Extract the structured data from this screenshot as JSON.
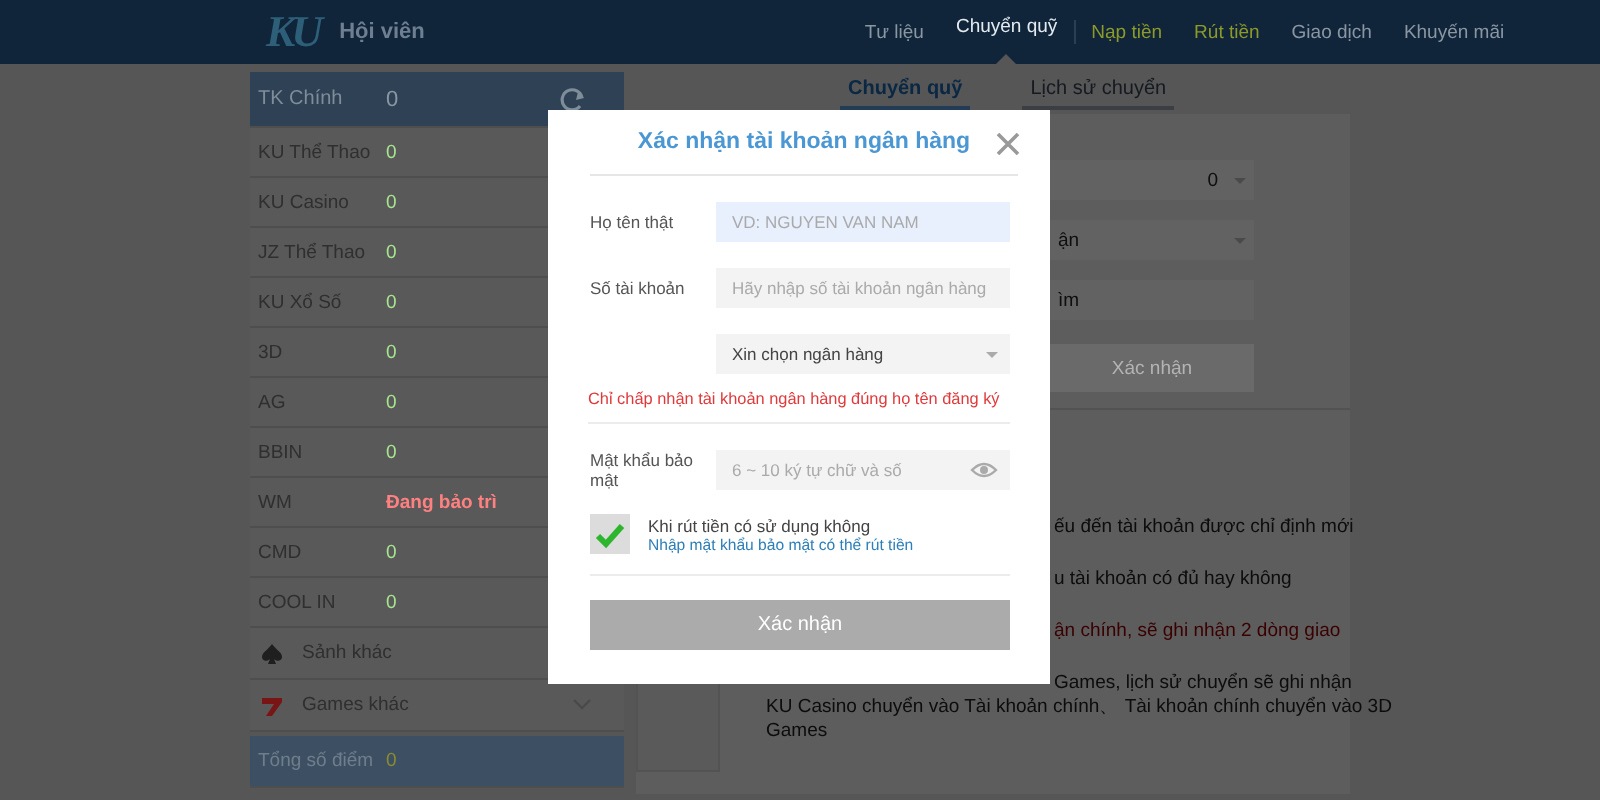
{
  "header": {
    "logo": "KU",
    "title": "Hội viên",
    "nav": [
      {
        "label": "Tư liệu",
        "selected": false,
        "kind": "normal"
      },
      {
        "label": "Chuyển quỹ",
        "selected": true,
        "kind": "normal"
      },
      {
        "label": "Nạp tiền",
        "selected": false,
        "kind": "highlight"
      },
      {
        "label": "Rút tiền",
        "selected": false,
        "kind": "highlight"
      },
      {
        "label": "Giao dịch",
        "selected": false,
        "kind": "normal"
      },
      {
        "label": "Khuyến mãi",
        "selected": false,
        "kind": "normal"
      }
    ]
  },
  "sidebar": {
    "main": {
      "label": "TK Chính",
      "value": "0"
    },
    "items": [
      {
        "kind": "balance",
        "label": "KU Thể Thao",
        "value": "0"
      },
      {
        "kind": "balance",
        "label": "KU Casino",
        "value": "0"
      },
      {
        "kind": "balance",
        "label": "JZ Thể Thao",
        "value": "0"
      },
      {
        "kind": "balance",
        "label": "KU Xổ Số",
        "value": "0"
      },
      {
        "kind": "balance",
        "label": "3D",
        "value": "0"
      },
      {
        "kind": "balance",
        "label": "AG",
        "value": "0"
      },
      {
        "kind": "balance",
        "label": "BBIN",
        "value": "0"
      },
      {
        "kind": "warning",
        "label": "WM",
        "value": "Đang bảo trì"
      },
      {
        "kind": "balance",
        "label": "CMD",
        "value": "0"
      },
      {
        "kind": "balance",
        "label": "COOL IN",
        "value": "0"
      },
      {
        "kind": "spade",
        "label": "Sảnh khác"
      },
      {
        "kind": "seven",
        "label": "Games khác"
      }
    ],
    "total": {
      "label": "Tổng số điểm",
      "value": "0"
    }
  },
  "tabs": [
    {
      "label": "Chuyển quỹ",
      "selected": true
    },
    {
      "label": "Lịch sử chuyển",
      "selected": false
    }
  ],
  "transfer": {
    "amount_select": "0",
    "target_select": "ận",
    "field": "ìm",
    "button": "Xác nhận",
    "notes": [
      {
        "kind": "partial",
        "text": "ếu đến tài khoản được chỉ định mới",
        "warning": false
      },
      {
        "kind": "partial",
        "text": "u tài khoản có đủ hay không",
        "warning": false
      },
      {
        "kind": "partial",
        "text": "ận chính, sẽ ghi nhận 2 dòng giao",
        "warning": true
      },
      {
        "kind": "partial",
        "text": "Games, lịch sử chuyển sẽ ghi nhận",
        "warning": false
      },
      {
        "kind": "full",
        "text": "KU Casino chuyển vào Tài khoản chính、 Tài khoản chính chuyển vào 3D",
        "warning": false
      },
      {
        "kind": "full",
        "text": "Games",
        "warning": false
      }
    ]
  },
  "modal": {
    "title": "Xác nhận tài khoản ngân hàng",
    "name_field": {
      "label": "Họ tên thật",
      "placeholder": "VD: NGUYEN VAN NAM"
    },
    "account_field": {
      "label": "Số tài khoản",
      "placeholder": "Hãy nhập số tài khoản ngân hàng"
    },
    "bank_select": {
      "value": "Xin chọn ngân hàng"
    },
    "note": "Chỉ chấp nhận tài khoản ngân hàng đúng họ tên đăng ký",
    "password_field": {
      "label": "Mật khẩu bảo mật",
      "placeholder": "6 ~ 10 ký tự chữ và số"
    },
    "option": {
      "checked": true,
      "text": "Khi rút tiền có sử dụng không",
      "hint": "Nhập mật khẩu bảo mật có thể rút tiền"
    },
    "button": "Xác nhận"
  }
}
